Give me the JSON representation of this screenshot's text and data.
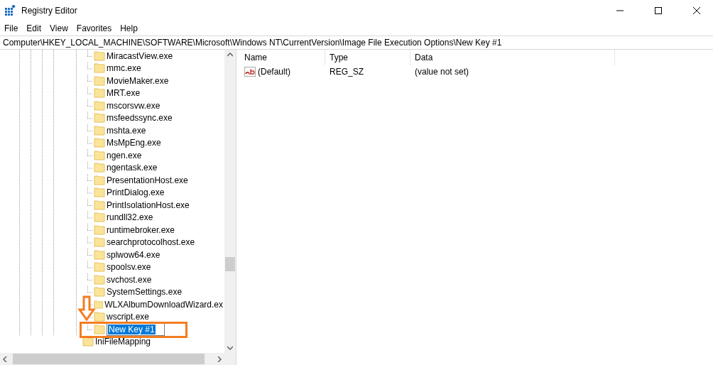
{
  "window": {
    "title": "Registry Editor"
  },
  "menu": [
    "File",
    "Edit",
    "View",
    "Favorites",
    "Help"
  ],
  "address": "Computer\\HKEY_LOCAL_MACHINE\\SOFTWARE\\Microsoft\\Windows NT\\CurrentVersion\\Image File Execution Options\\New Key #1",
  "tree": {
    "items": [
      {
        "label": "MiracastView.exe",
        "kind": "subkey",
        "editing": false
      },
      {
        "label": "mmc.exe",
        "kind": "subkey",
        "editing": false
      },
      {
        "label": "MovieMaker.exe",
        "kind": "subkey",
        "editing": false
      },
      {
        "label": "MRT.exe",
        "kind": "subkey",
        "editing": false
      },
      {
        "label": "mscorsvw.exe",
        "kind": "subkey",
        "editing": false
      },
      {
        "label": "msfeedssync.exe",
        "kind": "subkey",
        "editing": false
      },
      {
        "label": "mshta.exe",
        "kind": "subkey",
        "editing": false
      },
      {
        "label": "MsMpEng.exe",
        "kind": "subkey",
        "editing": false
      },
      {
        "label": "ngen.exe",
        "kind": "subkey",
        "editing": false
      },
      {
        "label": "ngentask.exe",
        "kind": "subkey",
        "editing": false
      },
      {
        "label": "PresentationHost.exe",
        "kind": "subkey",
        "editing": false
      },
      {
        "label": "PrintDialog.exe",
        "kind": "subkey",
        "editing": false
      },
      {
        "label": "PrintIsolationHost.exe",
        "kind": "subkey",
        "editing": false
      },
      {
        "label": "rundll32.exe",
        "kind": "subkey",
        "editing": false
      },
      {
        "label": "runtimebroker.exe",
        "kind": "subkey",
        "editing": false
      },
      {
        "label": "searchprotocolhost.exe",
        "kind": "subkey",
        "editing": false
      },
      {
        "label": "splwow64.exe",
        "kind": "subkey",
        "editing": false
      },
      {
        "label": "spoolsv.exe",
        "kind": "subkey",
        "editing": false
      },
      {
        "label": "svchost.exe",
        "kind": "subkey",
        "editing": false
      },
      {
        "label": "SystemSettings.exe",
        "kind": "subkey",
        "editing": false
      },
      {
        "label": "WLXAlbumDownloadWizard.ex",
        "kind": "subkey",
        "editing": false
      },
      {
        "label": "wscript.exe",
        "kind": "subkey",
        "editing": false
      },
      {
        "label": "New Key #1",
        "kind": "subkey",
        "editing": true
      },
      {
        "label": "IniFileMapping",
        "kind": "key",
        "editing": false
      }
    ]
  },
  "values": {
    "columns": [
      "Name",
      "Type",
      "Data"
    ],
    "rows": [
      {
        "name": "(Default)",
        "type": "REG_SZ",
        "data": "(value not set)"
      }
    ]
  }
}
